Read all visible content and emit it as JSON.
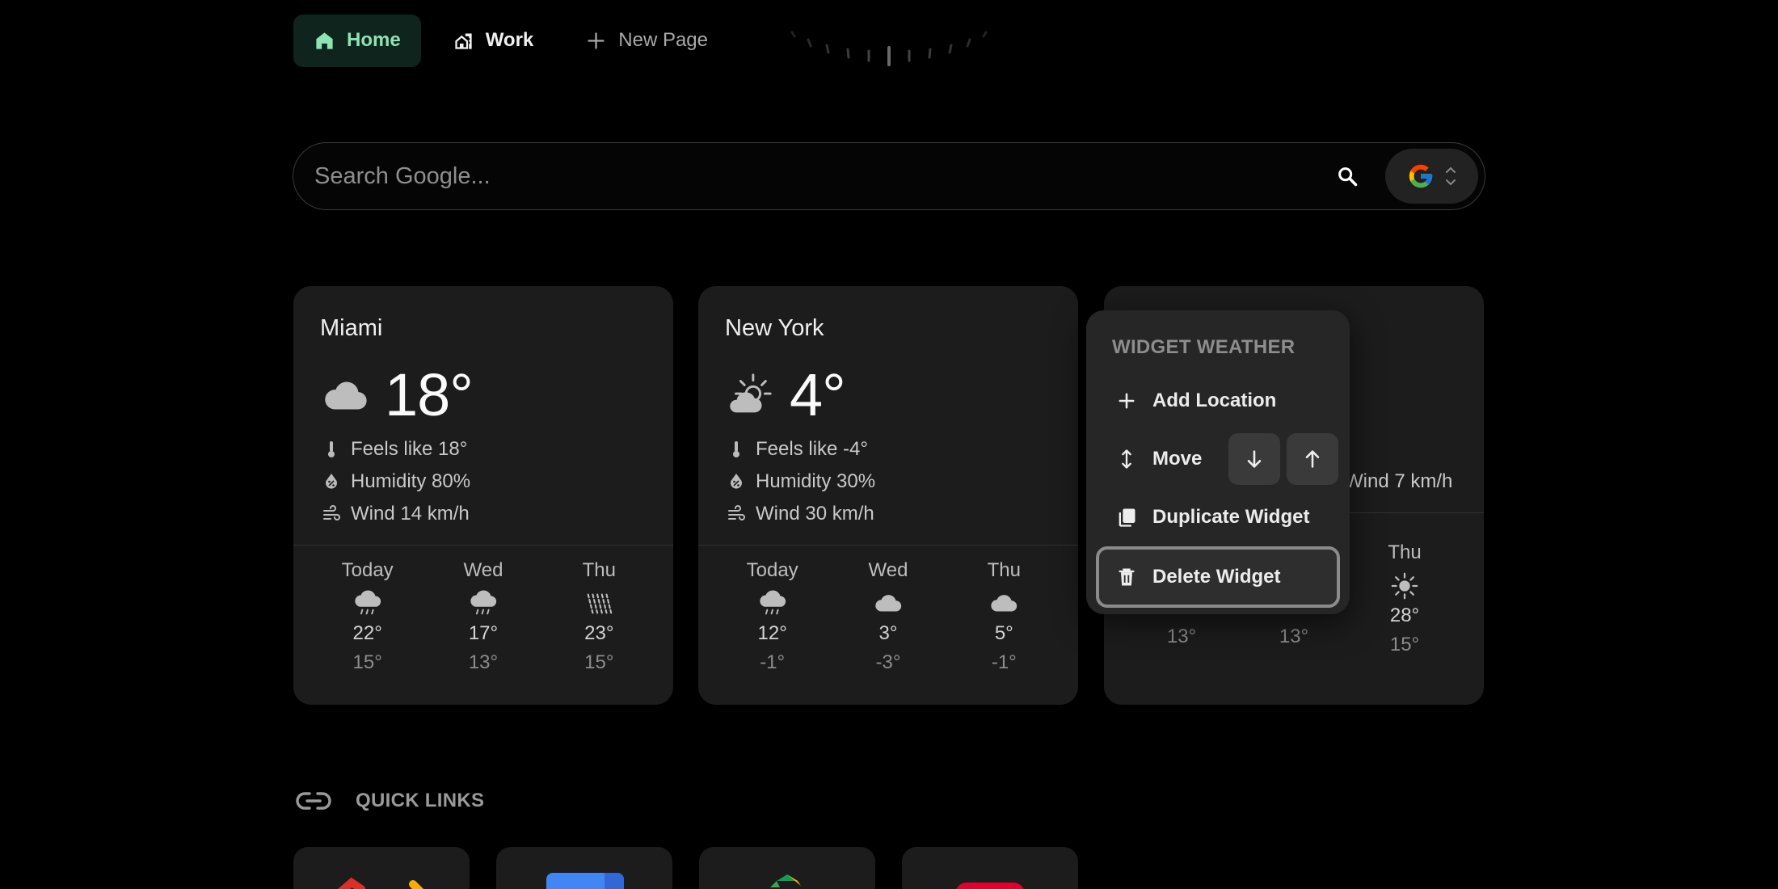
{
  "nav": {
    "tabs": [
      {
        "label": "Home",
        "icon": "home-icon",
        "active": true
      },
      {
        "label": "Work",
        "icon": "building-icon",
        "active": false
      }
    ],
    "new_page_label": "New Page"
  },
  "search": {
    "placeholder": "Search Google...",
    "engine": "Google"
  },
  "weather": [
    {
      "city": "Miami",
      "temp": "18°",
      "condition_icon": "cloud-icon",
      "feels_like": "Feels like 18°",
      "humidity": "Humidity 80%",
      "wind": "Wind 14 km/h",
      "forecast": [
        {
          "day": "Today",
          "icon": "rain-icon",
          "hi": "22°",
          "lo": "15°"
        },
        {
          "day": "Wed",
          "icon": "rain-icon",
          "hi": "17°",
          "lo": "13°"
        },
        {
          "day": "Thu",
          "icon": "heavy-rain-icon",
          "hi": "23°",
          "lo": "15°"
        }
      ]
    },
    {
      "city": "New York",
      "temp": "4°",
      "condition_icon": "partly-sunny-icon",
      "feels_like": "Feels like -4°",
      "humidity": "Humidity 30%",
      "wind": "Wind 30 km/h",
      "forecast": [
        {
          "day": "Today",
          "icon": "rain-icon",
          "hi": "12°",
          "lo": "-1°"
        },
        {
          "day": "Wed",
          "icon": "cloud-icon",
          "hi": "3°",
          "lo": "-3°"
        },
        {
          "day": "Thu",
          "icon": "cloud-icon",
          "hi": "5°",
          "lo": "-1°"
        }
      ]
    },
    {
      "wind": "Wind 7 km/h",
      "forecast": [
        {
          "lo": "13°"
        },
        {
          "lo": "13°"
        },
        {
          "day": "Thu",
          "icon": "sun-icon",
          "hi": "28°",
          "lo": "15°"
        }
      ]
    }
  ],
  "menu": {
    "title": "WIDGET WEATHER",
    "add_location": "Add Location",
    "move": "Move",
    "duplicate": "Duplicate Widget",
    "delete": "Delete Widget"
  },
  "quick_links": {
    "title": "QUICK LINKS"
  },
  "colors": {
    "accent": "#8ee3b3",
    "active_tab_bg": "#0f241c",
    "card_bg": "#1c1c1c",
    "menu_bg": "#262626"
  }
}
